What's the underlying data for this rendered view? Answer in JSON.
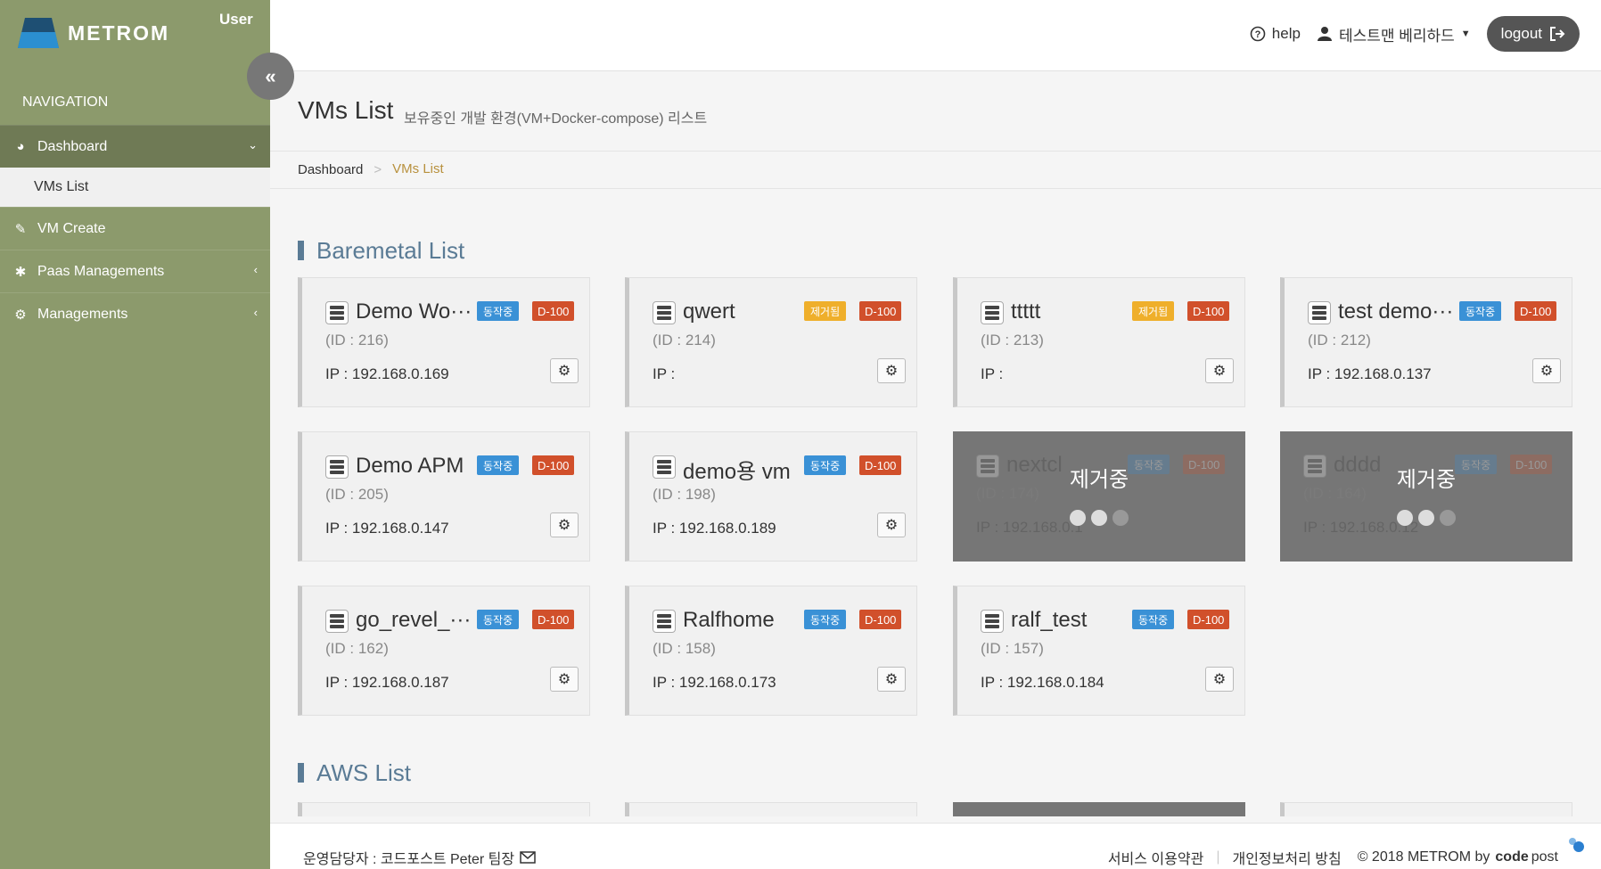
{
  "app": {
    "logo_text": "METROM",
    "user_label": "User",
    "collapse_glyph": "«"
  },
  "nav": {
    "title": "NAVIGATION",
    "dashboard": "Dashboard",
    "sub_vms": "VMs List",
    "vm_create": "VM Create",
    "paas": "Paas Managements",
    "managements": "Managements"
  },
  "header": {
    "help": "help",
    "username": "테스트맨 베리하드",
    "logout": "logout"
  },
  "page": {
    "title": "VMs List",
    "subtitle": "보유중인 개발 환경(VM+Docker-compose) 리스트",
    "breadcrumb": {
      "home": "Dashboard",
      "sep": ">",
      "current": "VMs List"
    }
  },
  "sections": {
    "baremetal": "Baremetal List",
    "aws": "AWS List"
  },
  "vms": [
    {
      "name": "Demo Wo···",
      "status": "동작중",
      "status_kind": "run",
      "plan": "D-100",
      "id": "(ID : 216)",
      "ip": "IP : 192.168.0.169"
    },
    {
      "name": "qwert",
      "status": "제거됨",
      "status_kind": "del",
      "plan": "D-100",
      "id": "(ID : 214)",
      "ip": "IP :"
    },
    {
      "name": "ttttt",
      "status": "제거됨",
      "status_kind": "del",
      "plan": "D-100",
      "id": "(ID : 213)",
      "ip": "IP :"
    },
    {
      "name": "test demo···",
      "status": "동작중",
      "status_kind": "run",
      "plan": "D-100",
      "id": "(ID : 212)",
      "ip": "IP : 192.168.0.137"
    },
    {
      "name": "Demo APM",
      "status": "동작중",
      "status_kind": "run",
      "plan": "D-100",
      "id": "(ID : 205)",
      "ip": "IP : 192.168.0.147"
    },
    {
      "name": "demo용 vm",
      "status": "동작중",
      "status_kind": "run",
      "plan": "D-100",
      "id": "(ID : 198)",
      "ip": "IP : 192.168.0.189"
    },
    {
      "name": "nextcl",
      "status": "동작중",
      "status_kind": "run",
      "plan": "D-100",
      "id": "(ID : 174)",
      "ip": "IP : 192.168.0.1",
      "overlay": "제거중"
    },
    {
      "name": "dddd",
      "status": "동작중",
      "status_kind": "run",
      "plan": "D-100",
      "id": "(ID : 164)",
      "ip": "IP : 192.168.0.12",
      "overlay": "제거중"
    },
    {
      "name": "go_revel_···",
      "status": "동작중",
      "status_kind": "run",
      "plan": "D-100",
      "id": "(ID : 162)",
      "ip": "IP : 192.168.0.187"
    },
    {
      "name": "Ralfhome",
      "status": "동작중",
      "status_kind": "run",
      "plan": "D-100",
      "id": "(ID : 158)",
      "ip": "IP : 192.168.0.173"
    },
    {
      "name": "ralf_test",
      "status": "동작중",
      "status_kind": "run",
      "plan": "D-100",
      "id": "(ID : 157)",
      "ip": "IP : 192.168.0.184"
    }
  ],
  "footer": {
    "manager": "운영담당자 : 코드포스트 Peter 팀장",
    "terms": "서비스 이용약관",
    "privacy": "개인정보처리 방침",
    "copyright": "© 2018 METROM by",
    "brand_code": "code",
    "brand_post": "post"
  },
  "colors": {
    "sidebar": "#8c9a6c",
    "accent": "#b8913e",
    "section": "#5a7b95",
    "run": "#3a91d6",
    "del": "#efaf2b",
    "plan": "#d1502b"
  }
}
